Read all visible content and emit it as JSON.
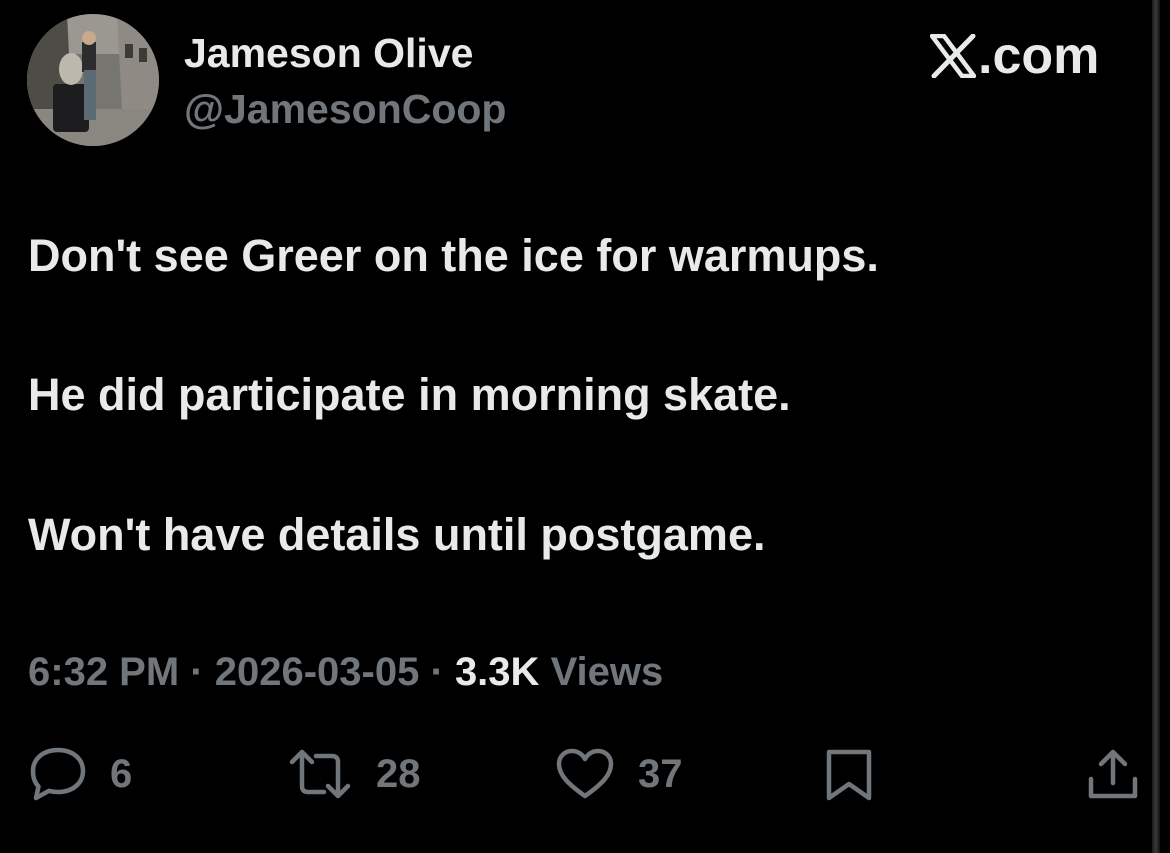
{
  "author": {
    "display_name": "Jameson Olive",
    "handle": "@JamesonCoop"
  },
  "brand": {
    "logo_text": ".com",
    "logo_icon": "x-logo-icon"
  },
  "tweet": {
    "lines": [
      "Don't see Greer on the ice for warmups.",
      "He did participate in morning skate.",
      "Won't have details until postgame."
    ]
  },
  "meta": {
    "time": "6:32 PM",
    "separator": "·",
    "date": "2026-03-05",
    "views_count": "3.3K",
    "views_label": "Views"
  },
  "actions": {
    "replies": "6",
    "reposts": "28",
    "likes": "37"
  },
  "colors": {
    "background": "#000000",
    "text_primary": "#e7e9ea",
    "text_secondary": "#71767b"
  }
}
